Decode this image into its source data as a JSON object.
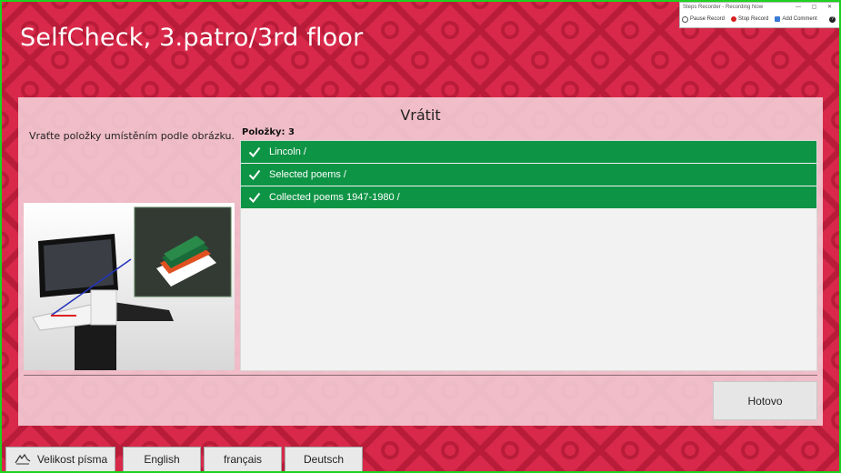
{
  "app": {
    "title": "SelfCheck, 3.patro/3rd floor"
  },
  "steps_recorder": {
    "title": "Steps Recorder - Recording Now",
    "controls": "—  ▢  ✕",
    "pause_label": "Pause Record",
    "stop_label": "Stop Record",
    "comment_label": "Add Comment",
    "help_label": "?"
  },
  "panel": {
    "title": "Vrátit",
    "instruction": "Vraťte položky umístěním podle obrázku.",
    "items_count": "Položky: 3",
    "items": [
      {
        "label": "Lincoln /"
      },
      {
        "label": "Selected poems /"
      },
      {
        "label": "Collected poems 1947-1980 /"
      }
    ],
    "done_label": "Hotovo"
  },
  "bottom_bar": {
    "font_size_label": "Velikost písma",
    "languages": [
      "English",
      "français",
      "Deutsch"
    ]
  },
  "colors": {
    "background": "#d8294a",
    "item_green": "#0e9445",
    "frame_green": "#1fd11f"
  },
  "icons": {
    "font_size": "hand-text-icon",
    "item_status": "checkmark-icon"
  }
}
